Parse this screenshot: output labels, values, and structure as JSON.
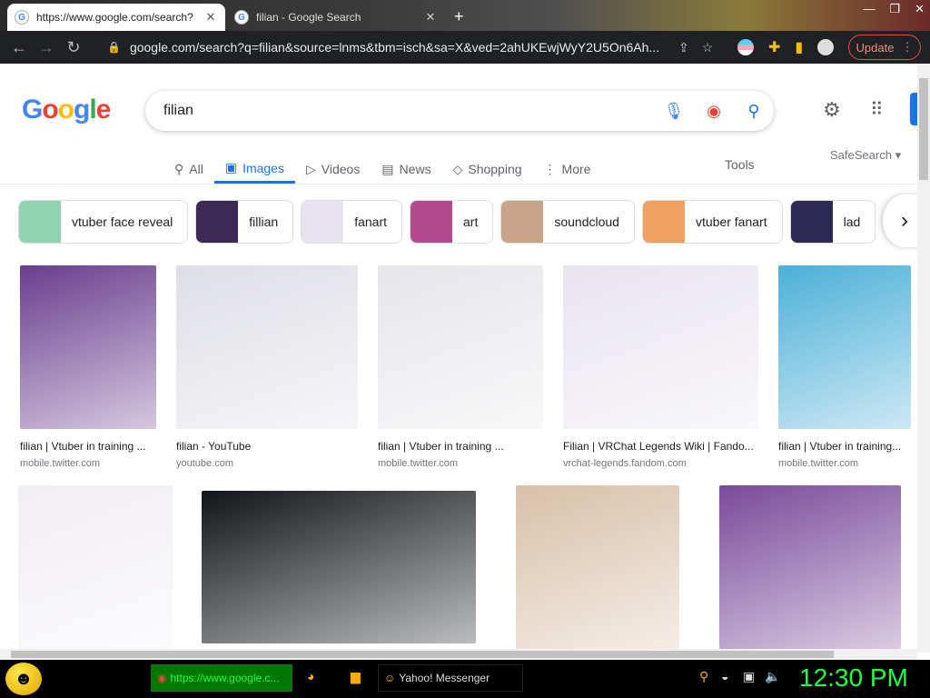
{
  "browser": {
    "tabs": [
      {
        "title": "https://www.google.com/search?",
        "active": true
      },
      {
        "title": "filian - Google Search",
        "active": false
      }
    ],
    "new_tab_symbol": "+",
    "url": "google.com/search?q=filian&source=lnms&tbm=isch&sa=X&ved=2ahUKEwjWyY2U5On6Ah...",
    "update_label": "Update"
  },
  "google": {
    "logo": [
      "G",
      "o",
      "o",
      "g",
      "l",
      "e"
    ],
    "logo_colors": [
      "#4285F4",
      "#EA4335",
      "#FBBC05",
      "#4285F4",
      "#34A853",
      "#EA4335"
    ],
    "query": "filian",
    "tabs": [
      {
        "label": "All",
        "icon": "search-icon"
      },
      {
        "label": "Images",
        "icon": "image-icon",
        "active": true
      },
      {
        "label": "Videos",
        "icon": "play-icon"
      },
      {
        "label": "News",
        "icon": "news-icon"
      },
      {
        "label": "Shopping",
        "icon": "tag-icon"
      },
      {
        "label": "More",
        "icon": "more-icon"
      }
    ],
    "tools_label": "Tools",
    "safesearch_label": "SafeSearch",
    "chips": [
      {
        "label": "vtuber face reveal",
        "color": "#8fd3b0"
      },
      {
        "label": "fillian",
        "color": "#3a2a55"
      },
      {
        "label": "fanart",
        "color": "#e9e3ef"
      },
      {
        "label": "art",
        "color": "#b24a8e"
      },
      {
        "label": "soundcloud",
        "color": "#c8a58a"
      },
      {
        "label": "vtuber fanart",
        "color": "#f0a060"
      },
      {
        "label": "lad",
        "color": "#2c2a55"
      }
    ],
    "results_row1": [
      {
        "title": "filian | Vtuber in training ...",
        "source": "mobile.twitter.com",
        "color": "#6a3d8e"
      },
      {
        "title": "filian - YouTube",
        "source": "youtube.com",
        "color": "#dedfe6"
      },
      {
        "title": "filian | Vtuber in training ...",
        "source": "mobile.twitter.com",
        "color": "#e6e6ea"
      },
      {
        "title": "Filian | VRChat Legends Wiki | Fando...",
        "source": "vrchat-legends.fandom.com",
        "color": "#e8e4ee"
      },
      {
        "title": "filian | Vtuber in training...",
        "source": "mobile.twitter.com",
        "color": "#4cb0d8"
      }
    ],
    "results_row2": [
      {
        "color": "#f1eef4"
      },
      {
        "color": "#111418"
      },
      {
        "color": "#d8c0a8"
      },
      {
        "color": "#7a4a9a"
      }
    ]
  },
  "taskbar": {
    "items": [
      {
        "label": "https://www.google.c...",
        "icon": "chrome-icon"
      },
      {
        "label": "Yahoo! Messenger",
        "icon": "smiley-icon"
      }
    ],
    "clock": "12:30 PM"
  }
}
